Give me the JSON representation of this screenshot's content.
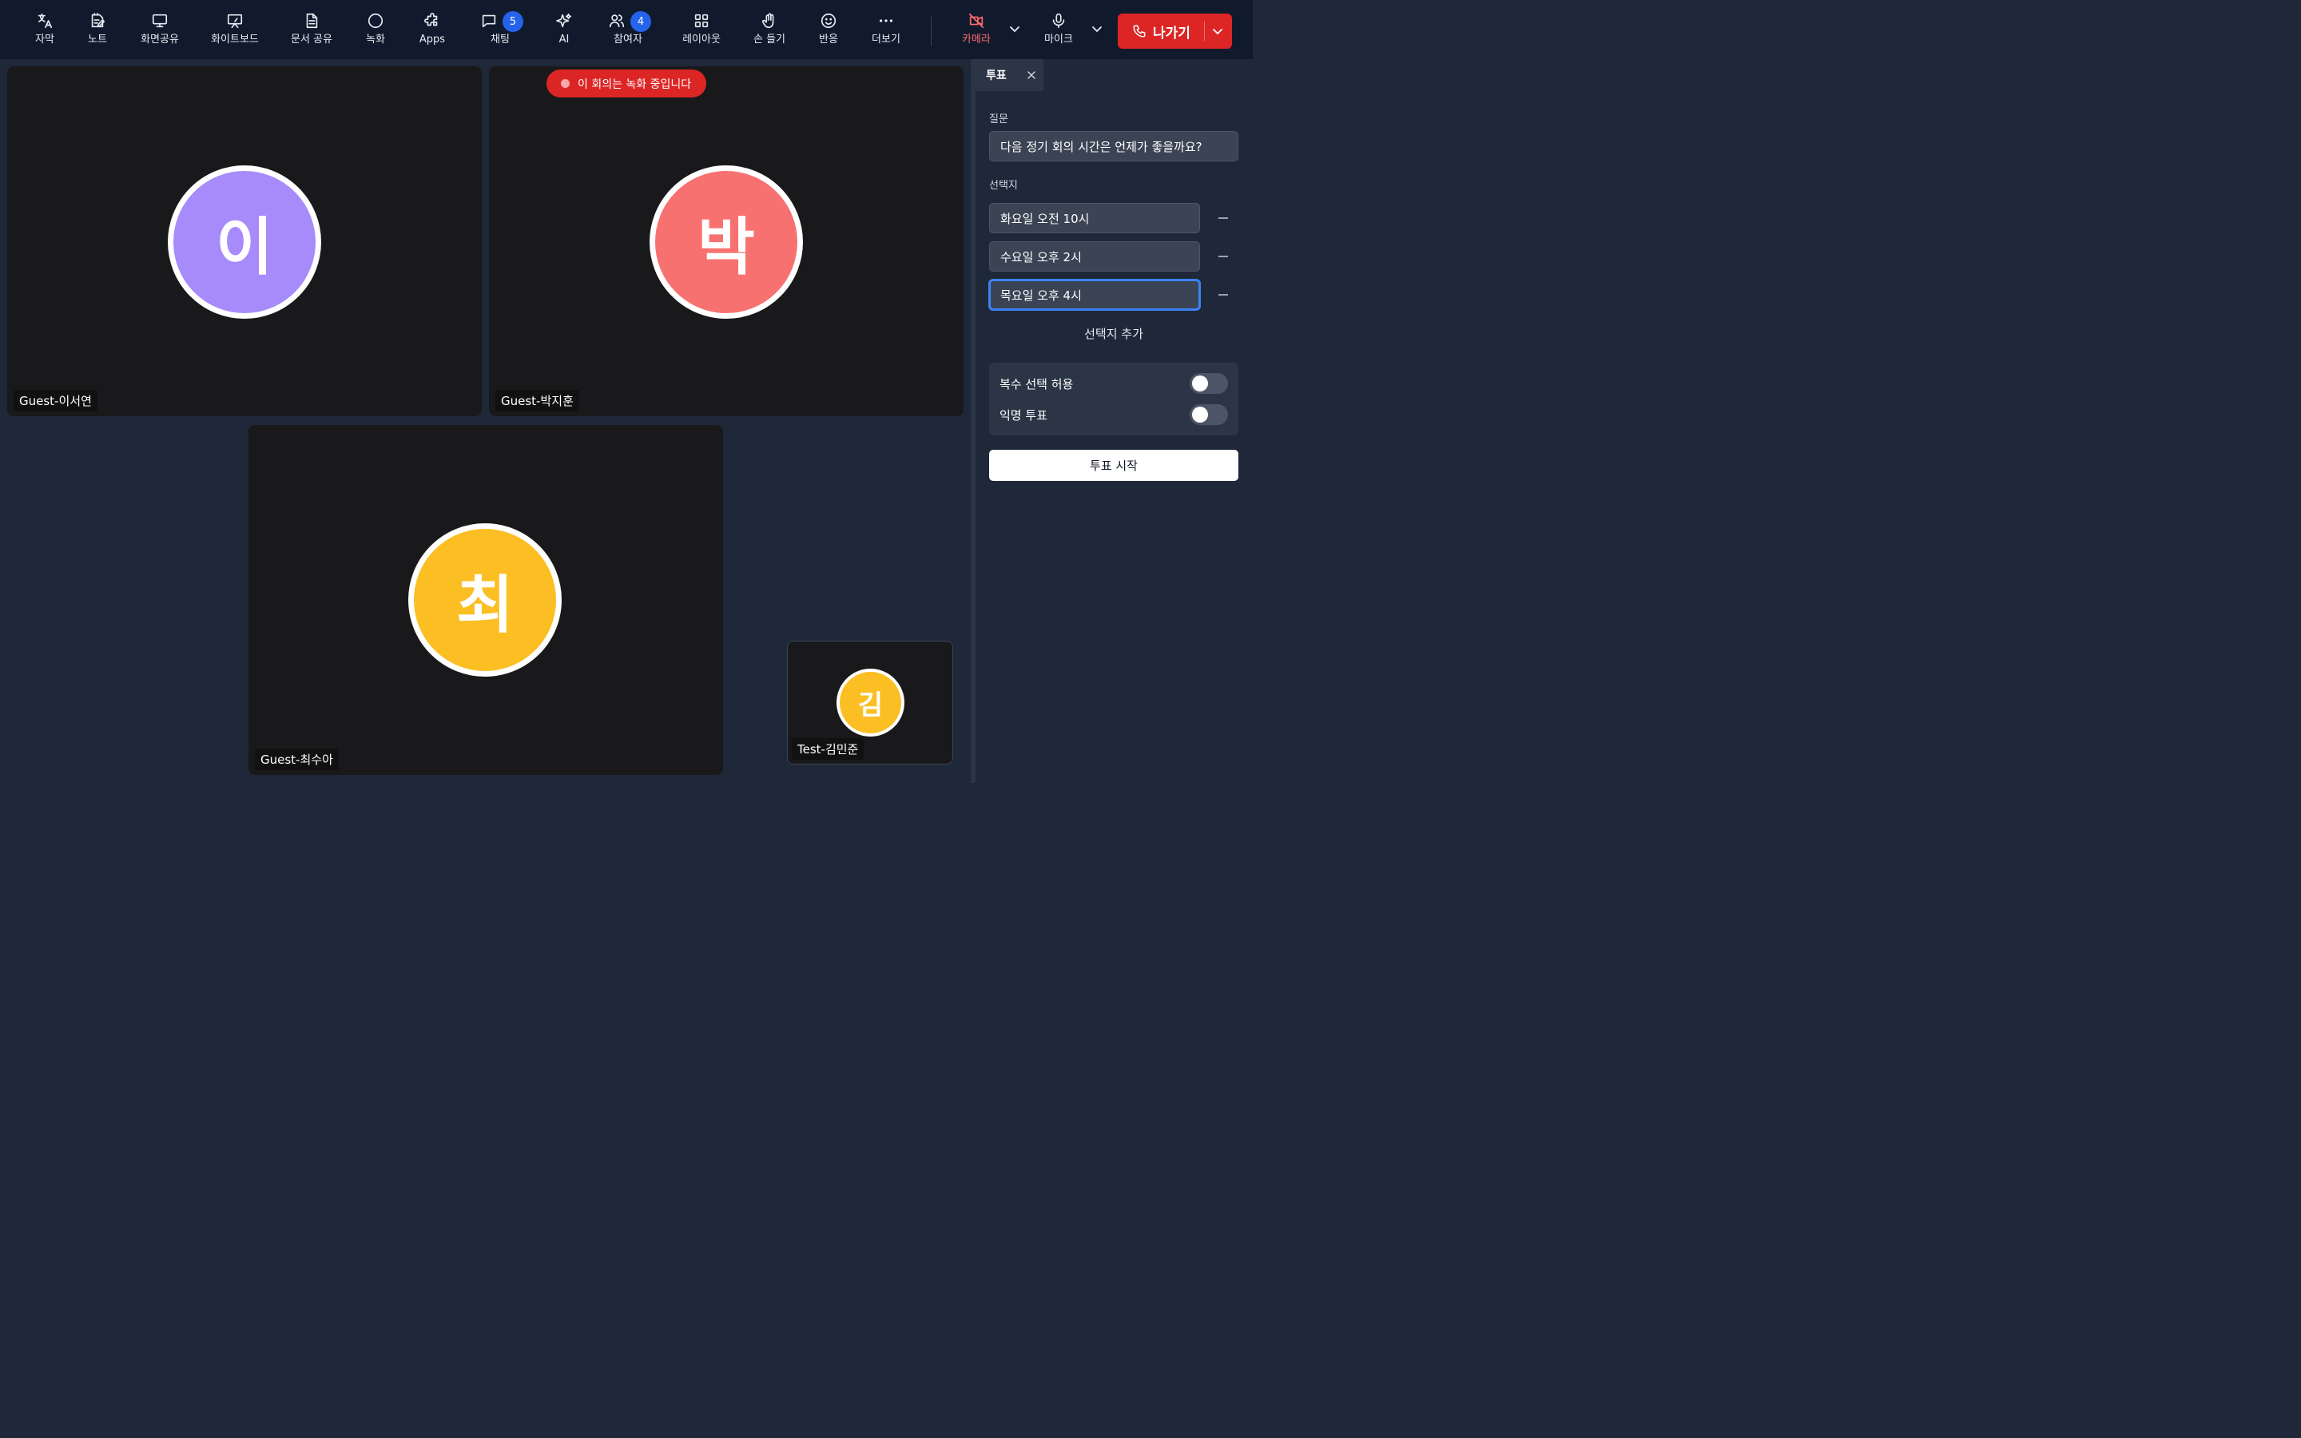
{
  "toolbar": {
    "items": [
      {
        "label": "자막",
        "icon": "translate-icon"
      },
      {
        "label": "노트",
        "icon": "note-icon"
      },
      {
        "label": "화면공유",
        "icon": "monitor-icon"
      },
      {
        "label": "화이트보드",
        "icon": "whiteboard-icon"
      },
      {
        "label": "문서 공유",
        "icon": "document-icon"
      },
      {
        "label": "녹화",
        "icon": "record-icon"
      },
      {
        "label": "Apps",
        "icon": "puzzle-icon"
      },
      {
        "label": "채팅",
        "icon": "chat-icon",
        "badge": "5"
      },
      {
        "label": "AI",
        "icon": "sparkle-icon"
      },
      {
        "label": "참여자",
        "icon": "users-icon",
        "badge": "4"
      },
      {
        "label": "레이아웃",
        "icon": "grid-icon"
      },
      {
        "label": "손 들기",
        "icon": "hand-icon"
      },
      {
        "label": "반응",
        "icon": "smile-icon"
      },
      {
        "label": "더보기",
        "icon": "more-icon"
      }
    ],
    "camera": {
      "label": "카메라",
      "state": "off"
    },
    "mic": {
      "label": "마이크"
    },
    "leave_label": "나가기",
    "colors": {
      "background": "#111a2c",
      "leave": "#dc2626",
      "badge": "#2563eb",
      "camera_off": "#ff6b6b"
    }
  },
  "recording_banner": "이 회의는 녹화 중입니다",
  "participants": [
    {
      "name": "Guest-이서연",
      "initial": "이",
      "color": "#a78bfa"
    },
    {
      "name": "Guest-박지훈",
      "initial": "박",
      "color": "#f87171"
    },
    {
      "name": "Guest-최수아",
      "initial": "최",
      "color": "#fbbf24"
    },
    {
      "name": "Test-김민준",
      "initial": "김",
      "color": "#fbbf24"
    }
  ],
  "poll_panel": {
    "tab_title": "투표",
    "question_label": "질문",
    "question": "다음 정기 회의 시간은 언제가 좋을까요?",
    "options_label": "선택지",
    "options": [
      "화요일 오전 10시",
      "수요일 오후 2시",
      "목요일 오후 4시"
    ],
    "add_option": "선택지 추가",
    "allow_multiple_label": "복수 선택 허용",
    "allow_multiple": false,
    "anonymous_label": "익명 투표",
    "anonymous": false,
    "start_button": "투표 시작"
  }
}
